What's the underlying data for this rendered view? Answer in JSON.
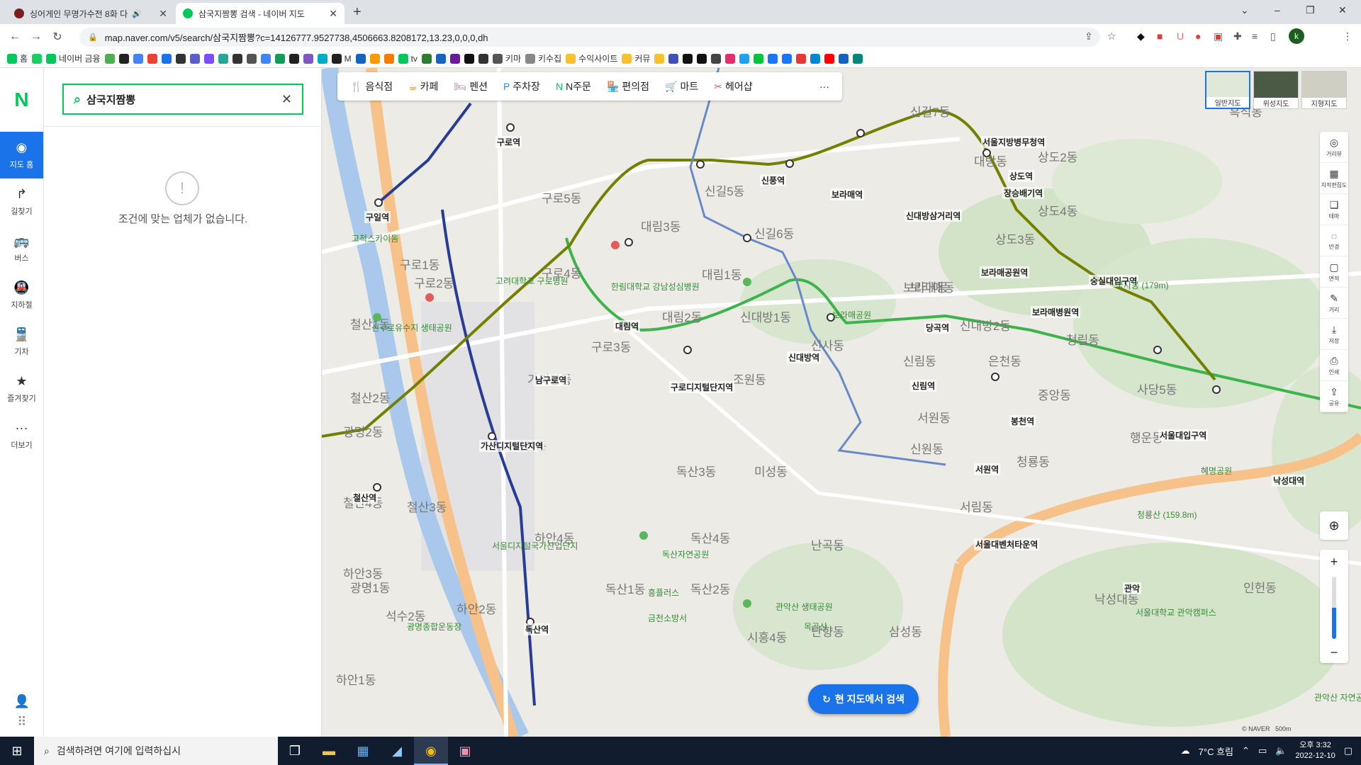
{
  "browser": {
    "tabs": [
      {
        "title": "싱어게인 무명가수전 8화 다",
        "favicon_color": "#7b1e1e"
      },
      {
        "title": "삼국지짬뽕 검색 - 네이버 지도",
        "favicon_color": "#03c75a"
      }
    ],
    "new_tab": "+",
    "window": {
      "minimize": "–",
      "restore": "❐",
      "close": "✕",
      "tabsearch": "⌄"
    },
    "url": "map.naver.com/v5/search/삼국지짬뽕?c=14126777.9527738,4506663.8208172,13.23,0,0,0,dh",
    "bookmarks": [
      {
        "label": "홈",
        "color": "#03c75a"
      },
      {
        "label": "",
        "color": "#19ce60"
      },
      {
        "label": "네이버 금융",
        "color": "#03c75a"
      },
      {
        "label": "",
        "color": "#4caf50"
      },
      {
        "label": "",
        "color": "#222"
      },
      {
        "label": "",
        "color": "#4285f4"
      },
      {
        "label": "",
        "color": "#ea4335"
      },
      {
        "label": "",
        "color": "#1a73e8"
      },
      {
        "label": "",
        "color": "#333"
      },
      {
        "label": "",
        "color": "#5b5fc7"
      },
      {
        "label": "",
        "color": "#7c4dff"
      },
      {
        "label": "",
        "color": "#26a69a"
      },
      {
        "label": "",
        "color": "#333"
      },
      {
        "label": "",
        "color": "#555"
      },
      {
        "label": "",
        "color": "#4285f4"
      },
      {
        "label": "",
        "color": "#0f9d58"
      },
      {
        "label": "",
        "color": "#222"
      },
      {
        "label": "",
        "color": "#7e57c2"
      },
      {
        "label": "",
        "color": "#00acc1"
      },
      {
        "label": "M",
        "color": "#222"
      },
      {
        "label": "",
        "color": "#1565c0"
      },
      {
        "label": "",
        "color": "#ff9900"
      },
      {
        "label": "",
        "color": "#f57c00"
      },
      {
        "label": "tv",
        "color": "#03c75a"
      },
      {
        "label": "",
        "color": "#2e7d32"
      },
      {
        "label": "",
        "color": "#1565c0"
      },
      {
        "label": "",
        "color": "#6a1b9a"
      },
      {
        "label": "",
        "color": "#111"
      },
      {
        "label": "",
        "color": "#333"
      },
      {
        "label": "키마",
        "color": "#555"
      },
      {
        "label": "키수집",
        "color": "#888"
      },
      {
        "label": "수익사이트",
        "color": "#fbc02d"
      },
      {
        "label": "커뮤",
        "color": "#fbc02d"
      },
      {
        "label": "",
        "color": "#fbc02d"
      },
      {
        "label": "",
        "color": "#3f51b5"
      },
      {
        "label": "",
        "color": "#111"
      },
      {
        "label": "",
        "color": "#111"
      },
      {
        "label": "",
        "color": "#444"
      },
      {
        "label": "",
        "color": "#e1306c"
      },
      {
        "label": "",
        "color": "#1da1f2"
      },
      {
        "label": "",
        "color": "#00c73c"
      },
      {
        "label": "",
        "color": "#1877f2"
      },
      {
        "label": "",
        "color": "#1877f2"
      },
      {
        "label": "",
        "color": "#e53935"
      },
      {
        "label": "",
        "color": "#0288d1"
      },
      {
        "label": "",
        "color": "#ff0000"
      },
      {
        "label": "",
        "color": "#1565c0"
      },
      {
        "label": "",
        "color": "#00897b"
      }
    ]
  },
  "rail": {
    "logo": "N",
    "items": [
      {
        "label": "지도 홈",
        "icon": "◉"
      },
      {
        "label": "길찾기",
        "icon": "↱"
      },
      {
        "label": "버스",
        "icon": "🚌"
      },
      {
        "label": "지하철",
        "icon": "🚇"
      },
      {
        "label": "기차",
        "icon": "🚆"
      },
      {
        "label": "즐겨찾기",
        "icon": "★"
      },
      {
        "label": "더보기",
        "icon": "···"
      }
    ]
  },
  "panel": {
    "query": "삼국지짬뽕",
    "empty_message": "조건에 맞는 업체가 없습니다.",
    "empty_icon": "!"
  },
  "map": {
    "categories": [
      {
        "label": "음식점",
        "icon": "🍴",
        "color": "#f0812d"
      },
      {
        "label": "카페",
        "icon": "☕",
        "color": "#f0812d"
      },
      {
        "label": "펜션",
        "icon": "🛏",
        "color": "#b96ec9"
      },
      {
        "label": "주차장",
        "icon": "P",
        "color": "#3b82f6"
      },
      {
        "label": "N주문",
        "icon": "N",
        "color": "#03c75a"
      },
      {
        "label": "편의점",
        "icon": "🏪",
        "color": "#f5a623"
      },
      {
        "label": "마트",
        "icon": "🛒",
        "color": "#f5a623"
      },
      {
        "label": "헤어샵",
        "icon": "✂",
        "color": "#e25a7a"
      }
    ],
    "more": "···",
    "layers": [
      {
        "label": "일반지도"
      },
      {
        "label": "위성지도"
      },
      {
        "label": "지형지도"
      }
    ],
    "tools": [
      {
        "label": "거리뷰",
        "icon": "◎"
      },
      {
        "label": "지적편집도",
        "icon": "▦"
      },
      {
        "label": "테마",
        "icon": "❏"
      },
      {
        "label": "반경",
        "icon": "◌"
      },
      {
        "label": "면적",
        "icon": "▢"
      },
      {
        "label": "거리",
        "icon": "✎"
      },
      {
        "label": "저장",
        "icon": "⤓"
      },
      {
        "label": "인쇄",
        "icon": "⎙"
      },
      {
        "label": "공유",
        "icon": "⇪"
      }
    ],
    "zoom_in": "+",
    "zoom_out": "−",
    "research_button": "현 지도에서 검색",
    "scale": "500m",
    "copyright": "© NAVER",
    "districts": [
      "대림3동",
      "신길5동",
      "신길6동",
      "대림1동",
      "대림2동",
      "신대방1동",
      "신사동",
      "조원동",
      "구로5동",
      "구로4동",
      "구로3동",
      "가리봉동",
      "가산동",
      "독산3동",
      "미성동",
      "독산4동",
      "독산2동",
      "시흥4동",
      "독산1동",
      "난곡동",
      "난향동",
      "삼성동",
      "신림동",
      "서원동",
      "신원동",
      "청룡동",
      "서림동",
      "낙성대동",
      "행운동",
      "중앙동",
      "청림동",
      "상도3동",
      "상도4동",
      "상도2동",
      "대방동",
      "신길7동",
      "보라매동",
      "은천동",
      "구로1동",
      "철산1동",
      "철산2동",
      "하안4동",
      "하안2동",
      "철산3동",
      "구로2동",
      "사당5동",
      "인헌동",
      "흑석동",
      "신대방2동",
      "보라매동",
      "광명2동",
      "광명1동",
      "하안1동",
      "하안3동",
      "철산4동",
      "석수2동"
    ],
    "stations": [
      "구로역",
      "구일역",
      "대림역",
      "신풍역",
      "보라매역",
      "신대방삼거리역",
      "장승배기역",
      "상도역",
      "숭실대입구역",
      "보라매공원역",
      "보라매병원역",
      "당곡역",
      "신림역",
      "신대방역",
      "구로디지털단지역",
      "남구로역",
      "가산디지털단지역",
      "철산역",
      "독산역",
      "서원역",
      "봉천역",
      "서울대입구역",
      "낙성대역",
      "서울대벤처타운역",
      "서울지방병무청역",
      "관악"
    ],
    "places": [
      "고려대학교 구로병원",
      "한림대학교 강남성심병원",
      "보라매공원",
      "관악산 생태공원",
      "서울대학교 관악캠퍼스",
      "관악산 자연공원",
      "독산자연공원",
      "혜명공원",
      "신구로유수지 생태공원",
      "고척스카이돔",
      "청룡산 (159.8m)",
      "국사봉 (179m)",
      "목골산",
      "금천소방서",
      "광명종합운동장",
      "흥플러스",
      "서울디지털국가산업단지"
    ]
  },
  "taskbar": {
    "search_placeholder": "검색하려면 여기에 입력하십시",
    "weather": "7°C 흐림",
    "time": "오후 3:32",
    "date": "2022-12-10"
  }
}
